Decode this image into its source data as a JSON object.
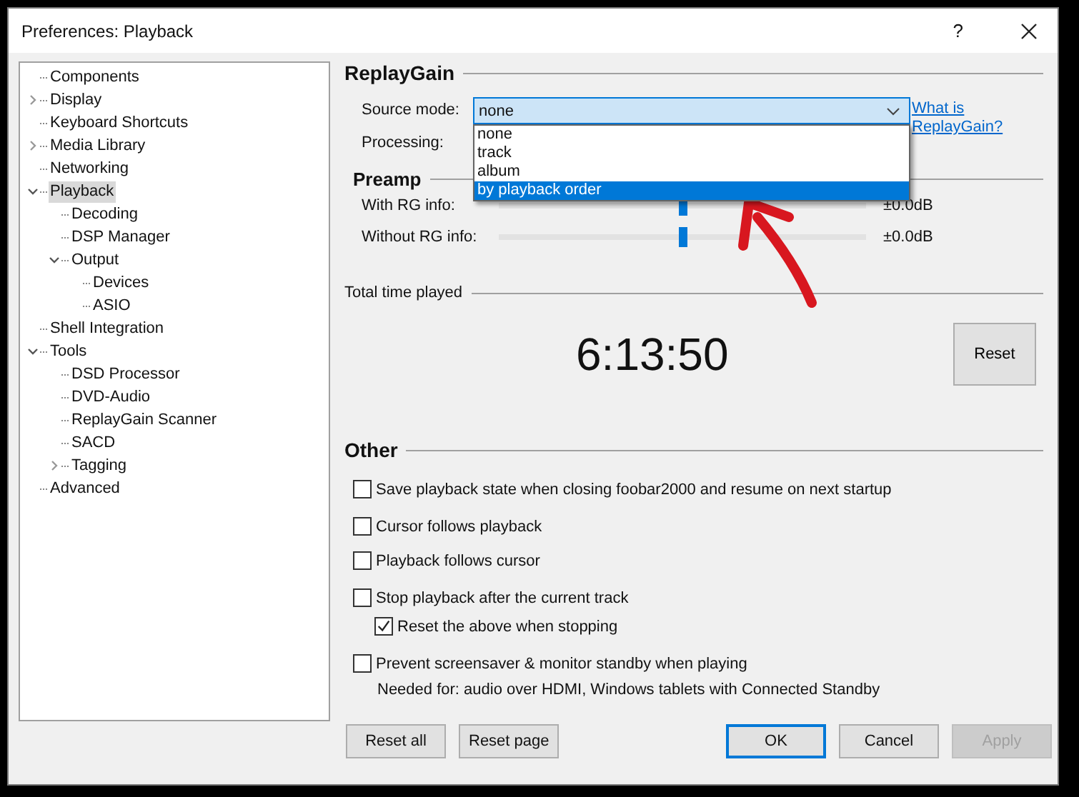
{
  "window": {
    "title": "Preferences: Playback",
    "help_label": "?"
  },
  "tree": [
    {
      "label": "Components",
      "selected": false
    },
    {
      "label": "Display",
      "selected": false,
      "expanded": false
    },
    {
      "label": "Keyboard Shortcuts",
      "selected": false
    },
    {
      "label": "Media Library",
      "selected": false,
      "expanded": false
    },
    {
      "label": "Networking",
      "selected": false
    },
    {
      "label": "Playback",
      "selected": true,
      "expanded": true,
      "children": [
        {
          "label": "Decoding",
          "selected": false
        },
        {
          "label": "DSP Manager",
          "selected": false
        },
        {
          "label": "Output",
          "selected": false,
          "expanded": true,
          "children": [
            {
              "label": "Devices",
              "selected": false
            },
            {
              "label": "ASIO",
              "selected": false
            }
          ]
        }
      ]
    },
    {
      "label": "Shell Integration",
      "selected": false
    },
    {
      "label": "Tools",
      "selected": false,
      "expanded": true,
      "children": [
        {
          "label": "DSD Processor",
          "selected": false
        },
        {
          "label": "DVD-Audio",
          "selected": false
        },
        {
          "label": "ReplayGain Scanner",
          "selected": false
        },
        {
          "label": "SACD",
          "selected": false
        },
        {
          "label": "Tagging",
          "selected": false,
          "expanded": false
        }
      ]
    },
    {
      "label": "Advanced",
      "selected": false
    }
  ],
  "replaygain": {
    "heading": "ReplayGain",
    "source_mode": {
      "label": "Source mode:",
      "value": "none",
      "open": true,
      "options": [
        {
          "label": "none",
          "highlighted": false
        },
        {
          "label": "track",
          "highlighted": false
        },
        {
          "label": "album",
          "highlighted": false
        },
        {
          "label": "by playback order",
          "highlighted": true
        }
      ]
    },
    "processing": {
      "label": "Processing:"
    },
    "link": "What is ReplayGain?"
  },
  "preamp": {
    "heading": "Preamp",
    "sliders": [
      {
        "label": "With RG info:",
        "level": 0.5,
        "reading": "±0.0dB"
      },
      {
        "label": "Without RG info:",
        "level": 0.5,
        "reading": "±0.0dB"
      }
    ]
  },
  "total_time": {
    "heading": "Total time played",
    "value": "6:13:50",
    "button": "Reset"
  },
  "other": {
    "heading": "Other",
    "groups": [
      [
        {
          "label": "Save playback state when closing foobar2000 and resume on next startup",
          "checked": false
        }
      ],
      [
        {
          "label": "Cursor follows playback",
          "checked": false
        },
        {
          "label": "Playback follows cursor",
          "checked": false
        }
      ],
      [
        {
          "label": "Stop playback after the current track",
          "checked": false,
          "children": [
            {
              "label": "Reset the above when stopping",
              "checked": true
            }
          ]
        }
      ],
      [
        {
          "label": "Prevent screensaver & monitor standby when playing",
          "checked": false,
          "note": "Needed for: audio over HDMI, Windows tablets with Connected Standby"
        }
      ]
    ]
  },
  "footer": {
    "left_buttons": [
      {
        "label": "Reset all",
        "default": false,
        "disabled": false
      },
      {
        "label": "Reset page",
        "default": false,
        "disabled": false
      }
    ],
    "right_buttons": [
      {
        "label": "OK",
        "default": true,
        "disabled": false
      },
      {
        "label": "Cancel",
        "default": false,
        "disabled": false
      },
      {
        "label": "Apply",
        "default": false,
        "disabled": true
      }
    ]
  }
}
